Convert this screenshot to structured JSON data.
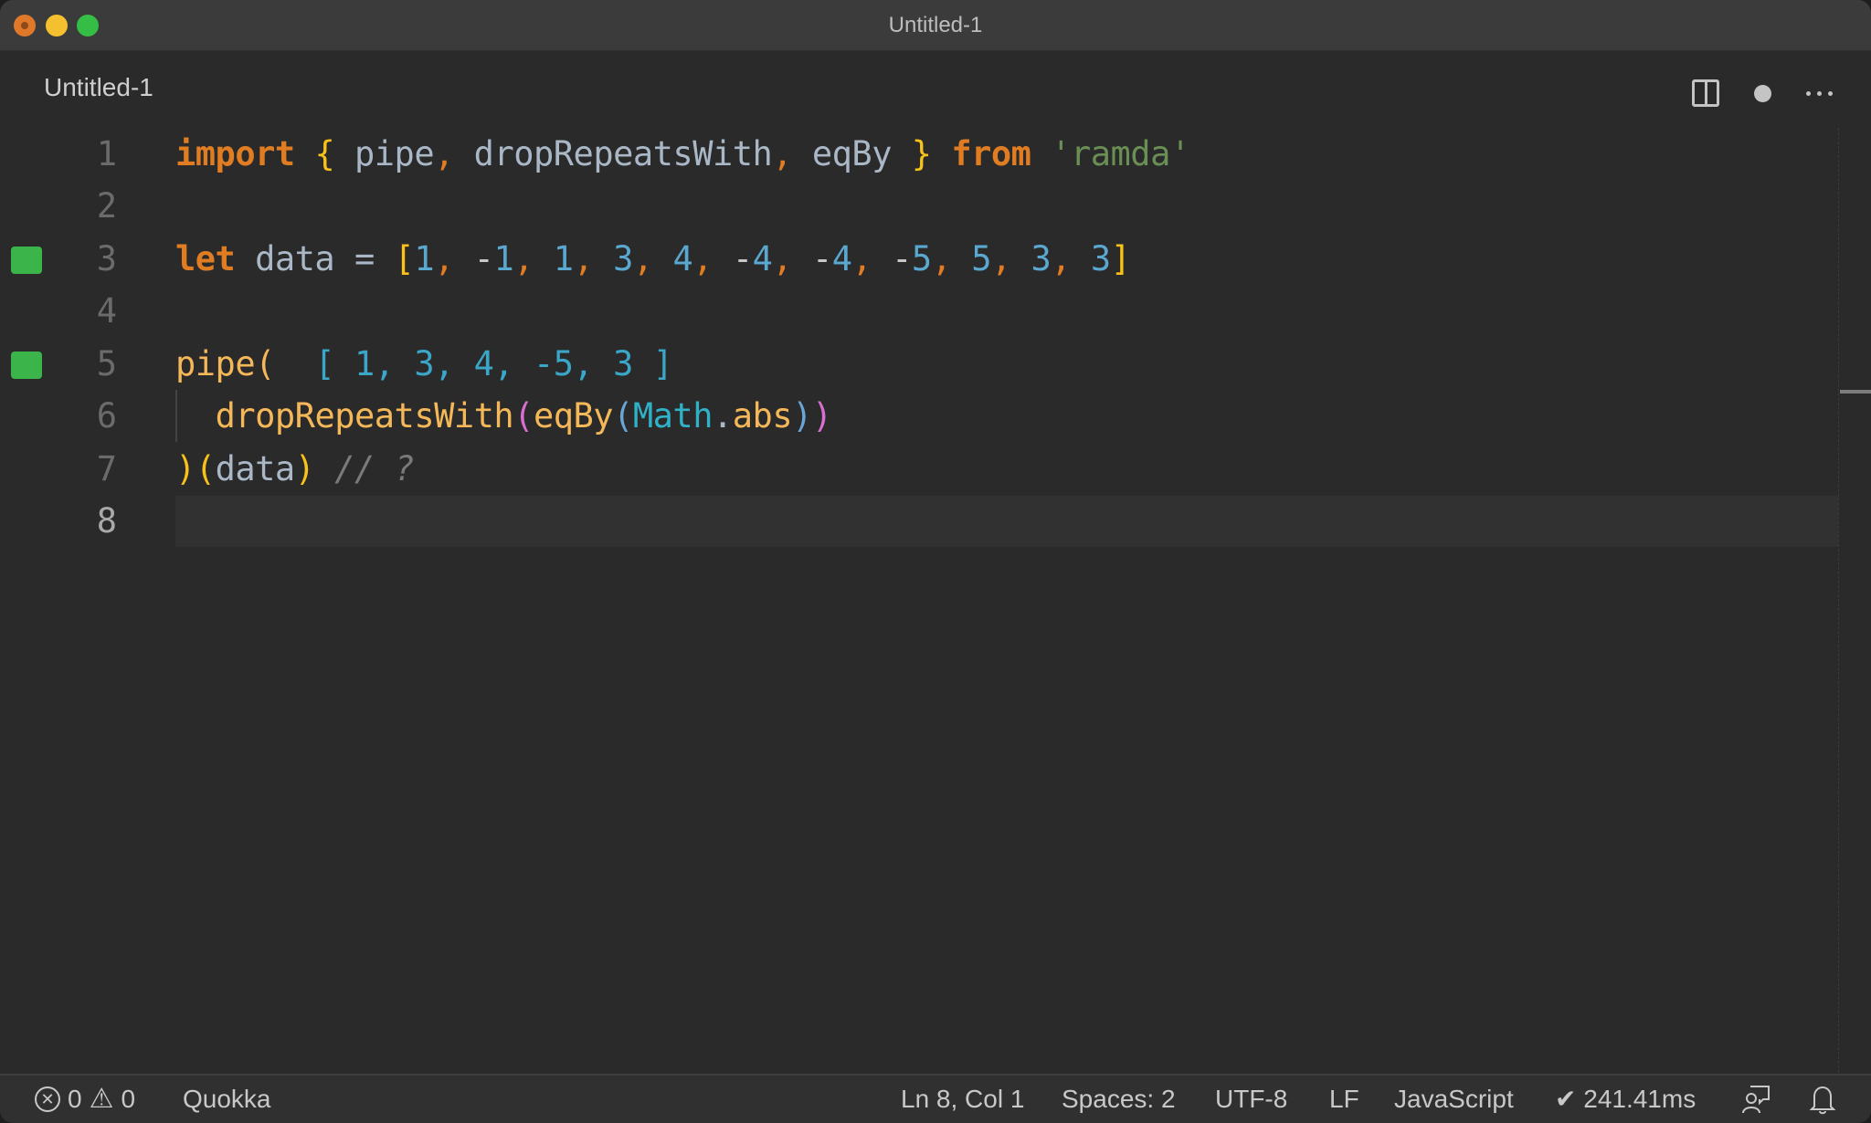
{
  "window": {
    "title": "Untitled-1",
    "traffic_lights": [
      "close",
      "minimize",
      "maximize"
    ]
  },
  "tab": {
    "label": "Untitled-1",
    "actions": [
      {
        "name": "split-editor-icon",
        "glyph": "split"
      },
      {
        "name": "unsaved-dot-icon",
        "glyph": "●"
      },
      {
        "name": "more-actions-icon",
        "glyph": "…"
      }
    ]
  },
  "editor": {
    "language": "JavaScript",
    "active_line": 8,
    "lines": [
      {
        "number": "1",
        "gutter_mark": false
      },
      {
        "number": "2",
        "gutter_mark": false
      },
      {
        "number": "3",
        "gutter_mark": true
      },
      {
        "number": "4",
        "gutter_mark": false
      },
      {
        "number": "5",
        "gutter_mark": true
      },
      {
        "number": "6",
        "gutter_mark": false
      },
      {
        "number": "7",
        "gutter_mark": false
      },
      {
        "number": "8",
        "gutter_mark": false
      }
    ],
    "tokens": {
      "l1": [
        "import",
        " ",
        "{",
        " pipe",
        ",",
        " dropRepeatsWith",
        ",",
        " eqBy ",
        "}",
        " ",
        "from",
        " ",
        "'ramda'"
      ],
      "l3": [
        "let",
        " data = ",
        "[",
        "1",
        ", ",
        "-",
        "1",
        ", ",
        "1",
        ", ",
        "3",
        ", ",
        "4",
        ", ",
        "-",
        "4",
        ", ",
        "-",
        "4",
        ", ",
        "-",
        "5",
        ", ",
        "5",
        ", ",
        "3",
        ", ",
        "3",
        "]"
      ],
      "l5_code": "pipe(",
      "l5_result": "  [ 1, 3, 4, -5, 3 ]",
      "l6": [
        "  ",
        "dropRepeatsWith",
        "(",
        "eqBy",
        "(",
        "Math",
        ".",
        "abs",
        ")",
        ")"
      ],
      "l7": [
        ")",
        "(",
        "data",
        ")",
        " ",
        "// ?"
      ]
    },
    "quokka_result": "[ 1, 3, 4, -5, 3 ]"
  },
  "colors": {
    "keyword": "#e07d23",
    "string": "#6a8f55",
    "number": "#5aa7d0",
    "function": "#f5b859",
    "gutter_marker": "#3bb54a",
    "background": "#2a2a2a"
  },
  "statusbar": {
    "errors": "0",
    "warnings": "0",
    "quokka": "Quokka",
    "cursor": "Ln 8, Col 1",
    "spaces": "Spaces: 2",
    "encoding": "UTF-8",
    "eol": "LF",
    "language": "JavaScript",
    "timing": "✔ 241.41ms"
  }
}
